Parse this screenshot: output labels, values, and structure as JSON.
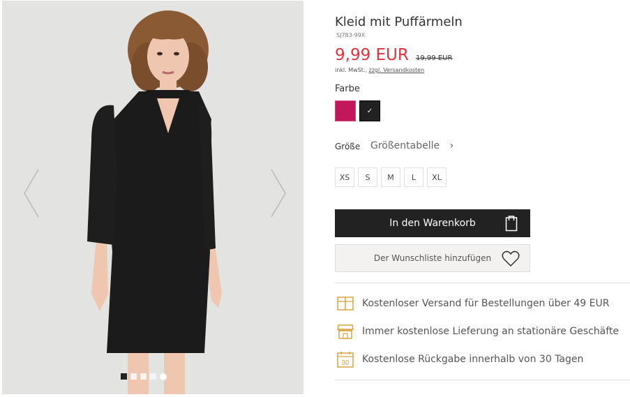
{
  "product": {
    "title": "Kleid mit Puffärmeln",
    "sku": "SJ783-99X",
    "price": "9,99 EUR",
    "old_price": "19,99 EUR",
    "tax_note": "inkl. MwSt.,",
    "shipping_link": "zzgl. Versandkosten"
  },
  "color": {
    "label": "Farbe",
    "options": [
      {
        "name": "pink",
        "hex": "#c2185b",
        "selected": false
      },
      {
        "name": "black",
        "hex": "#222222",
        "selected": true
      }
    ],
    "check": "✓"
  },
  "size": {
    "label": "Größe",
    "chart_link": "Größentabelle",
    "chevron": "›",
    "options": [
      "XS",
      "S",
      "M",
      "L",
      "XL"
    ]
  },
  "buttons": {
    "cart": "In den Warenkorb",
    "wishlist": "Der Wunschliste hinzufügen"
  },
  "perks": [
    {
      "icon": "parcel-icon",
      "text": "Kostenloser Versand für Bestellungen über 49 EUR"
    },
    {
      "icon": "store-icon",
      "text": "Immer kostenlose Lieferung an stationäre Geschäfte"
    },
    {
      "icon": "calendar-30-icon",
      "text": "Kostenlose Rückgabe innerhalb von 30 Tagen",
      "badge": "30"
    }
  ],
  "gallery": {
    "slide_count": 5,
    "active_slide": 1
  },
  "colors": {
    "accent_red": "#e2323d",
    "icon_gold": "#d9a440",
    "button_dark": "#222222"
  }
}
